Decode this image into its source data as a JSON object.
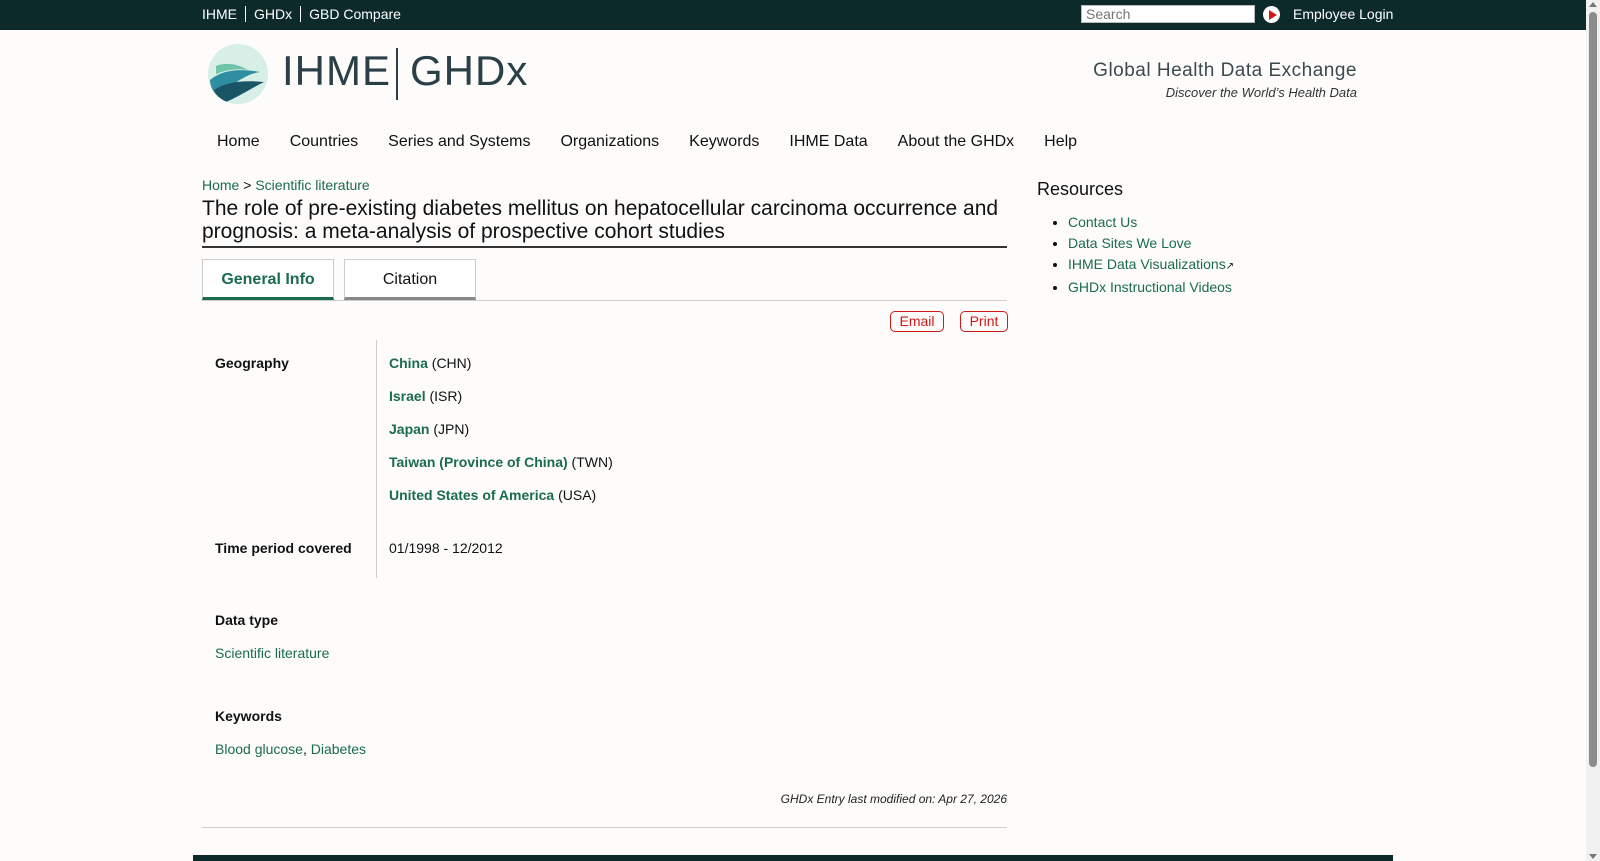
{
  "topbar": {
    "links": [
      "IHME",
      "GHDx",
      "GBD Compare"
    ],
    "search_placeholder": "Search",
    "login": "Employee Login"
  },
  "header": {
    "logo_left": "IHME",
    "logo_right": "GHDx",
    "tagline": "Global Health Data Exchange",
    "subtagline": "Discover the World’s Health Data"
  },
  "nav": [
    "Home",
    "Countries",
    "Series and Systems",
    "Organizations",
    "Keywords",
    "IHME Data",
    "About the GHDx",
    "Help"
  ],
  "breadcrumb": {
    "home": "Home",
    "sep": ">",
    "section": "Scientific literature"
  },
  "page_title": "The role of pre-existing diabetes mellitus on hepatocellular carcinoma occurrence and prognosis: a meta-analysis of prospective cohort studies",
  "tabs": [
    "General Info",
    "Citation"
  ],
  "actions": {
    "email": "Email",
    "print": "Print"
  },
  "info": {
    "geography_label": "Geography",
    "geography": [
      {
        "name": "China",
        "code": "(CHN)"
      },
      {
        "name": "Israel",
        "code": "(ISR)"
      },
      {
        "name": "Japan",
        "code": "(JPN)"
      },
      {
        "name": "Taiwan (Province of China)",
        "code": "(TWN)"
      },
      {
        "name": "United States of America",
        "code": "(USA)"
      }
    ],
    "time_label": "Time period covered",
    "time_value": "01/1998 - 12/2012",
    "datatype_label": "Data type",
    "datatype_value": "Scientific literature",
    "keywords_label": "Keywords",
    "keywords": [
      "Blood glucose",
      "Diabetes"
    ],
    "keywords_sep": ", "
  },
  "modified": "GHDx Entry last modified on: Apr 27, 2026",
  "resources": {
    "title": "Resources",
    "links": [
      "Contact Us",
      "Data Sites We Love",
      "IHME Data Visualizations",
      "GHDx Instructional Videos"
    ]
  },
  "colors": {
    "accent": "#1b6b4e",
    "topbar": "#0d2a2b",
    "action_red": "#d01818"
  }
}
